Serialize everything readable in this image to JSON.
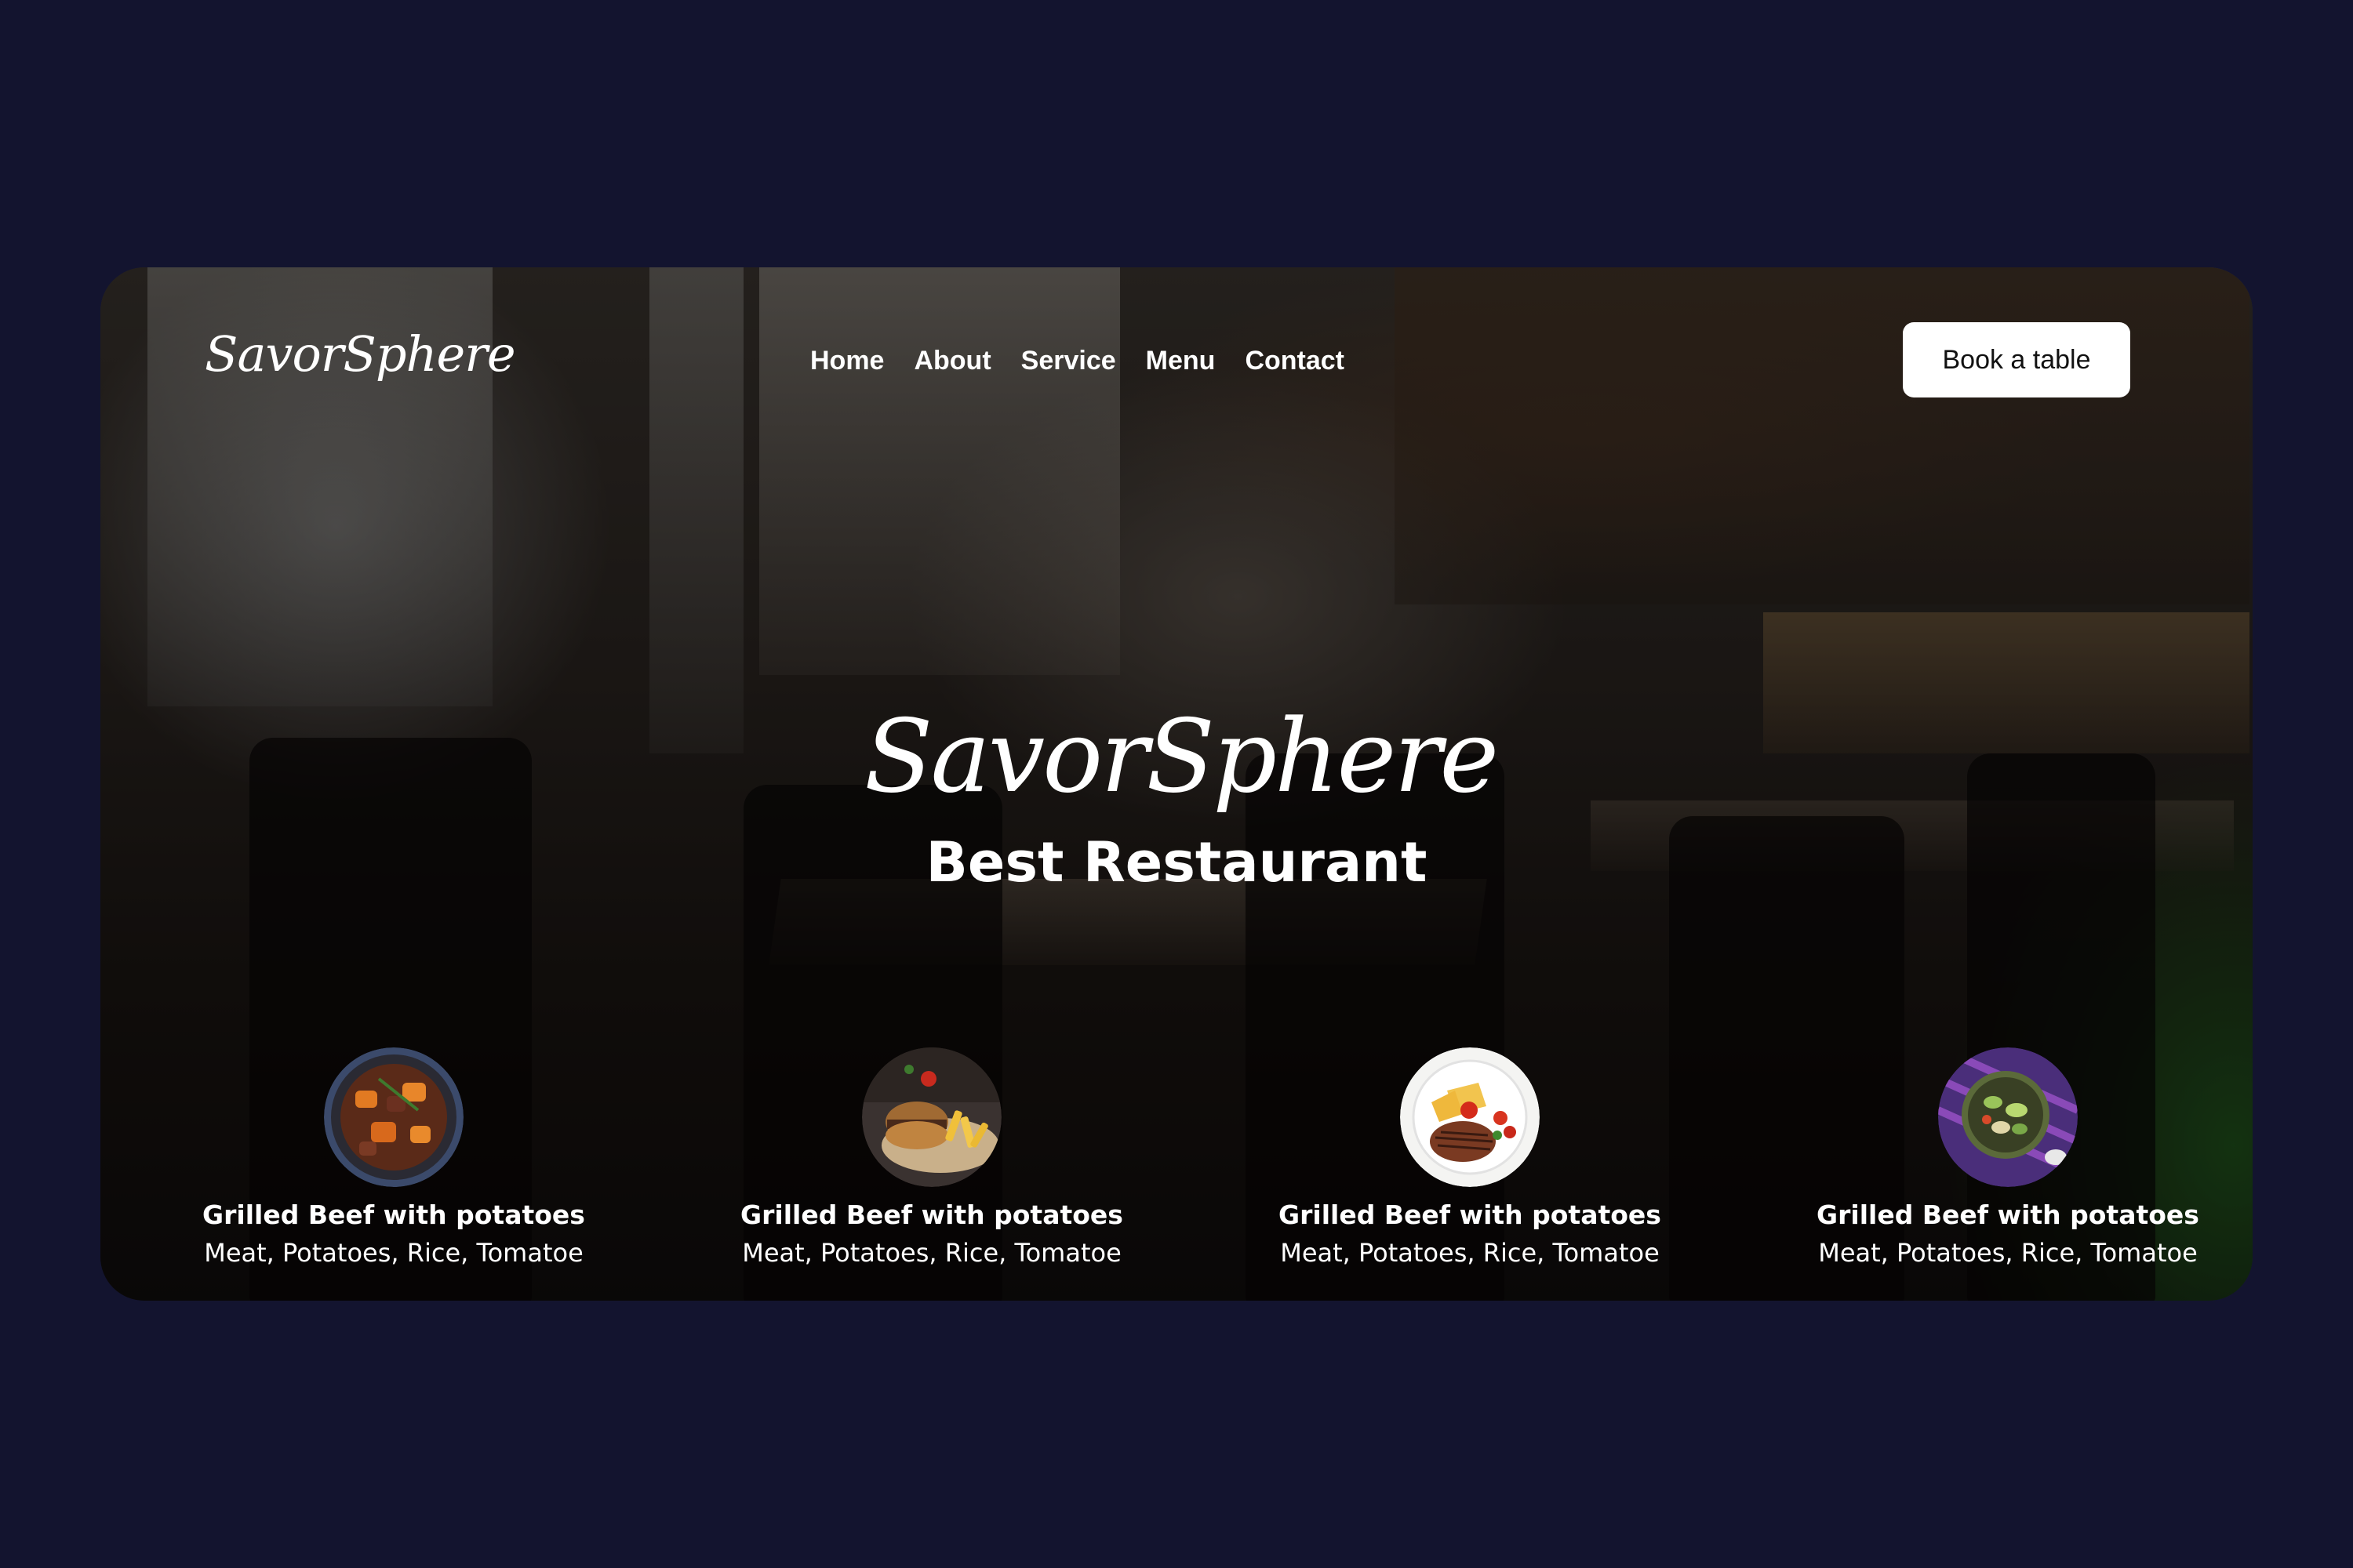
{
  "header": {
    "logo_text": "SavorSphere",
    "nav": [
      "Home",
      "About",
      "Service",
      "Menu",
      "Contact"
    ],
    "cta_label": "Book a table"
  },
  "hero": {
    "script_title": "SavorSphere",
    "title": "Best Restaurant"
  },
  "dishes": [
    {
      "name": "Grilled Beef with potatoes",
      "ingredients": "Meat, Potatoes, Rice, Tomatoe",
      "image": "beef-stew-bowl"
    },
    {
      "name": "Grilled Beef with potatoes",
      "ingredients": "Meat, Potatoes, Rice, Tomatoe",
      "image": "burger-fries-board"
    },
    {
      "name": "Grilled Beef with potatoes",
      "ingredients": "Meat, Potatoes, Rice, Tomatoe",
      "image": "steak-potatoes-plate"
    },
    {
      "name": "Grilled Beef with potatoes",
      "ingredients": "Meat, Potatoes, Rice, Tomatoe",
      "image": "salad-bowl"
    }
  ],
  "colors": {
    "page_background": "#13142f",
    "text": "#ffffff",
    "button_background": "#ffffff",
    "button_text": "#111111"
  }
}
